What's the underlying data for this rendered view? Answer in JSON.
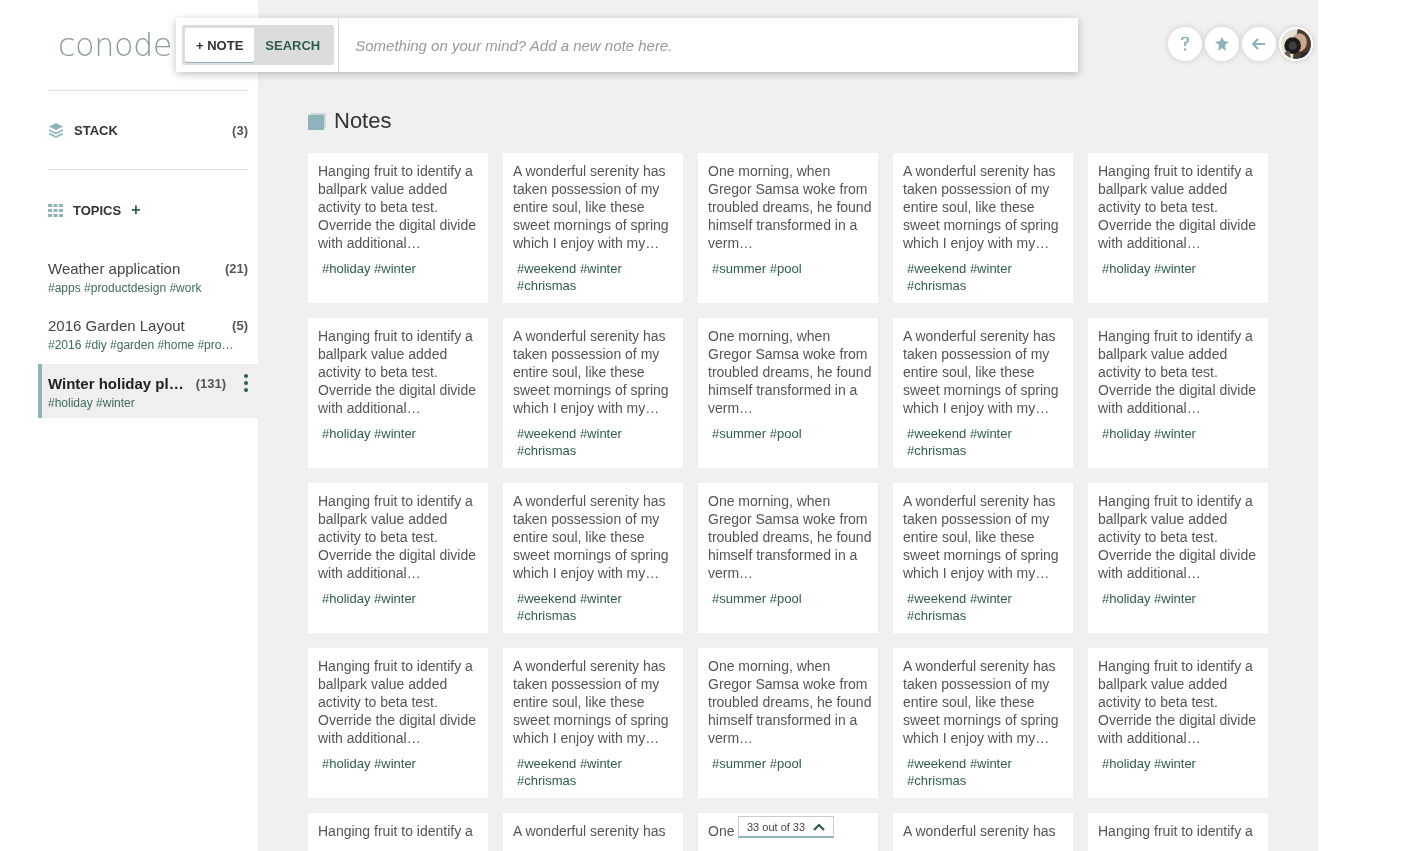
{
  "logo": "conode",
  "toolbar": {
    "tabs": [
      {
        "label": "+ NOTE",
        "selected": true
      },
      {
        "label": "SEARCH",
        "selected": false
      }
    ],
    "placeholder": "Something on your mind? Add a new note here."
  },
  "sidebar": {
    "stack": {
      "label": "STACK",
      "count": "(3)"
    },
    "topics": {
      "label": "TOPICS",
      "add": "+"
    },
    "items": [
      {
        "title": "Weather application",
        "count": "(21)",
        "tags": "#apps #productdesign #work",
        "selected": false
      },
      {
        "title": "2016 Garden Layout",
        "count": "(5)",
        "tags": "#2016 #diy #garden #home #pro…",
        "selected": false
      },
      {
        "title": "Winter holiday pl…",
        "count": "(131)",
        "tags": "#holiday #winter",
        "selected": true
      }
    ]
  },
  "notes": {
    "title": "Notes",
    "rows": [
      [
        {
          "text": "Hanging fruit to identify a ballpark value added activity to beta test. Override the digital divide with additional…",
          "tags": "#holiday #winter"
        },
        {
          "text": "A wonderful serenity has taken possession of my entire soul, like these sweet mornings of spring which I enjoy with my…",
          "tags": "#weekend #winter #chrismas"
        },
        {
          "text": "One morning, when Gregor Samsa woke from troubled dreams, he found himself transformed in a verm…",
          "tags": "#summer #pool"
        },
        {
          "text": "A wonderful serenity has taken possession of my entire soul, like these sweet mornings of spring which I enjoy with my…",
          "tags": "#weekend #winter #chrismas"
        },
        {
          "text": "Hanging fruit to identify a ballpark value added activity to beta test. Override the digital divide with additional…",
          "tags": "#holiday #winter"
        }
      ],
      [
        {
          "text": "Hanging fruit to identify a ballpark value added activity to beta test. Override the digital divide with additional…",
          "tags": "#holiday #winter"
        },
        {
          "text": "A wonderful serenity has taken possession of my entire soul, like these sweet mornings of spring which I enjoy with my…",
          "tags": "#weekend #winter #chrismas"
        },
        {
          "text": "One morning, when Gregor Samsa woke from troubled dreams, he found himself transformed in a verm…",
          "tags": "#summer #pool"
        },
        {
          "text": "A wonderful serenity has taken possession of my entire soul, like these sweet mornings of spring which I enjoy with my…",
          "tags": "#weekend #winter #chrismas"
        },
        {
          "text": "Hanging fruit to identify a ballpark value added activity to beta test. Override the digital divide with additional…",
          "tags": "#holiday #winter"
        }
      ],
      [
        {
          "text": "Hanging fruit to identify a ballpark value added activity to beta test. Override the digital divide with additional…",
          "tags": "#holiday #winter"
        },
        {
          "text": "A wonderful serenity has taken possession of my entire soul, like these sweet mornings of spring which I enjoy with my…",
          "tags": "#weekend #winter #chrismas"
        },
        {
          "text": "One morning, when Gregor Samsa woke from troubled dreams, he found himself transformed in a verm…",
          "tags": "#summer #pool"
        },
        {
          "text": "A wonderful serenity has taken possession of my entire soul, like these sweet mornings of spring which I enjoy with my…",
          "tags": "#weekend #winter #chrismas"
        },
        {
          "text": "Hanging fruit to identify a ballpark value added activity to beta test. Override the digital divide with additional…",
          "tags": "#holiday #winter"
        }
      ],
      [
        {
          "text": "Hanging fruit to identify a ballpark value added activity to beta test. Override the digital divide with additional…",
          "tags": "#holiday #winter"
        },
        {
          "text": "A wonderful serenity has taken possession of my entire soul, like these sweet mornings of spring which I enjoy with my…",
          "tags": "#weekend #winter #chrismas"
        },
        {
          "text": "One morning, when Gregor Samsa woke from troubled dreams, he found himself transformed in a verm…",
          "tags": "#summer #pool"
        },
        {
          "text": "A wonderful serenity has taken possession of my entire soul, like these sweet mornings of spring which I enjoy with my…",
          "tags": "#weekend #winter #chrismas"
        },
        {
          "text": "Hanging fruit to identify a ballpark value added activity to beta test. Override the digital divide with additional…",
          "tags": "#holiday #winter"
        }
      ],
      [
        {
          "text": "Hanging fruit to identify a"
        },
        {
          "text": "A wonderful serenity has"
        },
        {
          "text": "One"
        },
        {
          "text": "A wonderful serenity has"
        },
        {
          "text": "Hanging fruit to identify a"
        }
      ]
    ]
  },
  "pager": {
    "label": "33 out of 33"
  }
}
